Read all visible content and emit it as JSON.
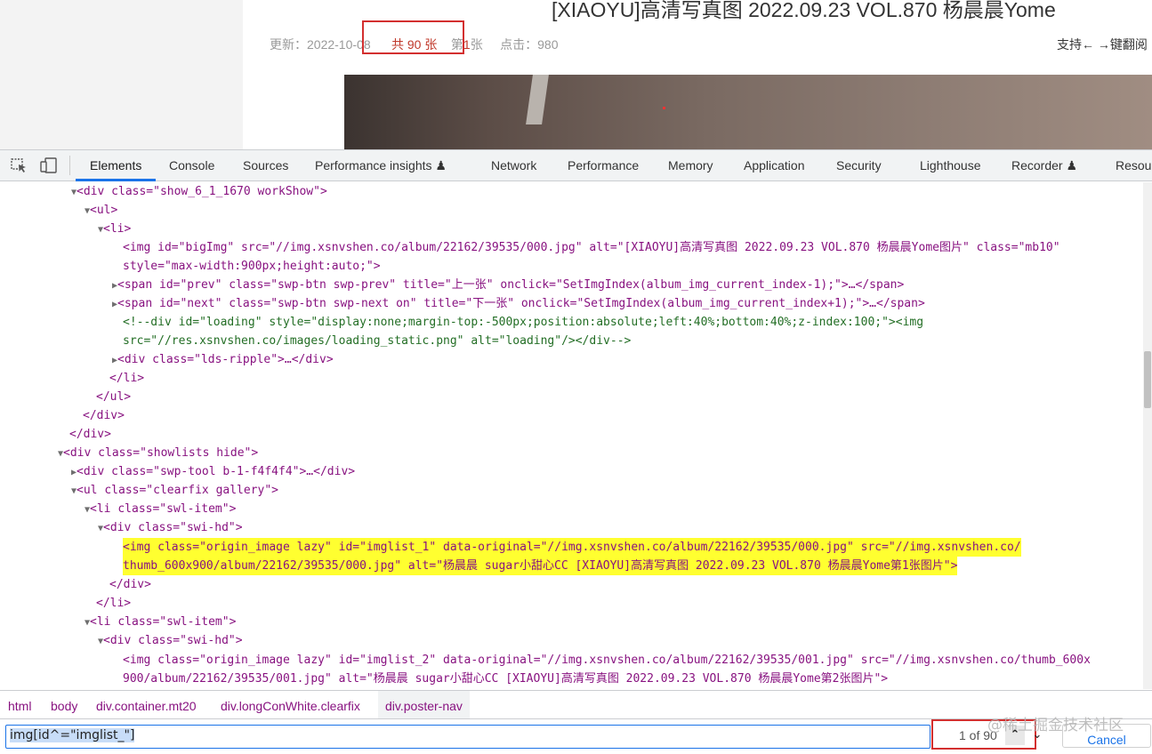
{
  "webpage": {
    "title": "[XIAOYU]高清写真图 2022.09.23 VOL.870 杨晨晨Yome",
    "meta": {
      "updated": "更新：2022-10-08",
      "total": "共 90 张",
      "page_prefix": "第 ",
      "page_num": "1",
      "page_suffix": " 张",
      "clicks": "点击：980"
    },
    "support_text": "支持← →键翻阅"
  },
  "devtools": {
    "tabs": [
      "Elements",
      "Console",
      "Sources",
      "Performance insights ♟",
      "Network",
      "Performance",
      "Memory",
      "Application",
      "Security",
      "Lighthouse",
      "Recorder ♟",
      "Resou"
    ],
    "active_tab": "Elements",
    "code_lines": [
      "<div class=\"show_6_1_1670 workShow\">",
      "<ul>",
      "<li>",
      "<img id=\"bigImg\" src=\"//img.xsnvshen.co/album/22162/39535/000.jpg\" alt=\"[XIAOYU]高清写真图 2022.09.23 VOL.870 杨晨晨Yome图片\" class=\"mb10\"",
      "style=\"max-width:900px;height:auto;\">",
      "<span id=\"prev\" class=\"swp-btn swp-prev\" title=\"上一张\" onclick=\"SetImgIndex(album_img_current_index-1);\">…</span>",
      "<span id=\"next\" class=\"swp-btn swp-next on\" title=\"下一张\" onclick=\"SetImgIndex(album_img_current_index+1);\">…</span>",
      "<!--div id=\"loading\" style=\"display:none;margin-top:-500px;position:absolute;left:40%;bottom:40%;z-index:100;\"><img",
      "src=\"//res.xsnvshen.co/images/loading_static.png\" alt=\"loading\"/></div-->",
      "<div class=\"lds-ripple\">…</div>",
      "</li>",
      "</ul>",
      "</div>",
      "</div>",
      "<div class=\"showlists hide\">",
      "<div class=\"swp-tool b-1-f4f4f4\">…</div>",
      "<ul class=\"clearfix gallery\">",
      "<li class=\"swl-item\">",
      "<div class=\"swi-hd\">",
      "<img class=\"origin_image lazy\" id=\"imglist_1\" data-original=\"//img.xsnvshen.co/album/22162/39535/000.jpg\" src=\"//img.xsnvshen.co/",
      "thumb_600x900/album/22162/39535/000.jpg\" alt=\"杨晨晨 sugar小甜心CC [XIAOYU]高清写真图 2022.09.23 VOL.870 杨晨晨Yome第1张图片\">",
      "</div>",
      "</li>",
      "<li class=\"swl-item\">",
      "<div class=\"swi-hd\">",
      "<img class=\"origin_image lazy\" id=\"imglist_2\" data-original=\"//img.xsnvshen.co/album/22162/39535/001.jpg\" src=\"//img.xsnvshen.co/thumb_600x",
      "900/album/22162/39535/001.jpg\" alt=\"杨晨晨 sugar小甜心CC [XIAOYU]高清写真图 2022.09.23 VOL.870 杨晨晨Yome第2张图片\">"
    ],
    "breadcrumbs": [
      "html",
      "body",
      "div.container.mt20",
      "div.longConWhite.clearfix",
      "div.poster-nav"
    ],
    "search": {
      "query": "img[id^=\"imglist_\"]",
      "match_count": "1 of 90",
      "cancel_label": "Cancel"
    },
    "watermark": "@稀土掘金技术社区"
  }
}
